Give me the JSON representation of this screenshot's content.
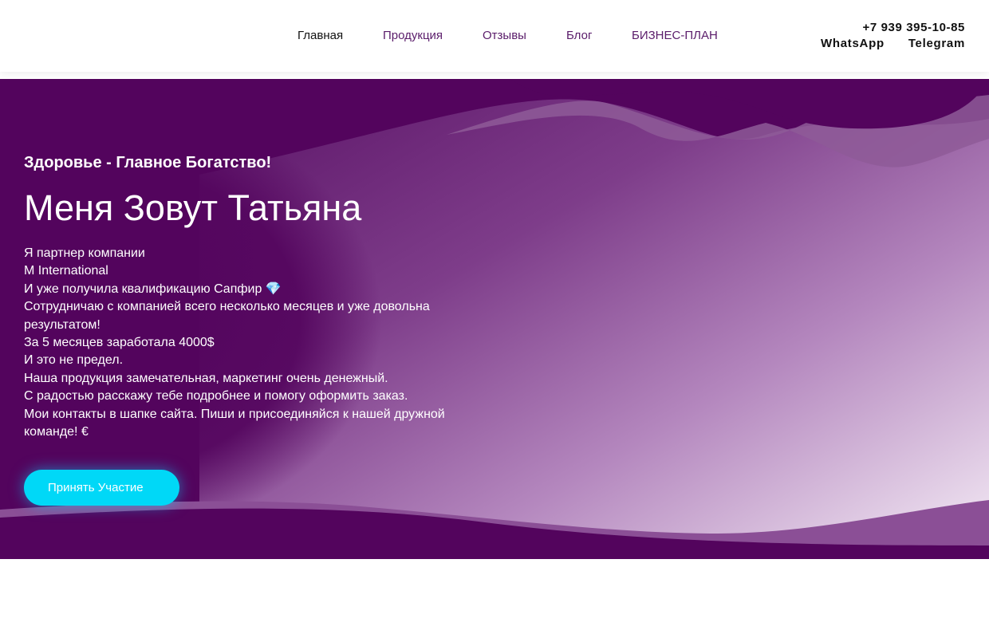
{
  "header": {
    "nav": [
      {
        "label": "Главная",
        "active": true
      },
      {
        "label": "Продукция",
        "active": false
      },
      {
        "label": "Отзывы",
        "active": false
      },
      {
        "label": "Блог",
        "active": false
      },
      {
        "label": "БИЗНЕС-ПЛАН",
        "active": false
      }
    ],
    "phone": "+7 939 395-10-85",
    "whatsapp": "WhatsApp",
    "telegram": "Telegram"
  },
  "hero": {
    "subtitle": "Здоровье - Главное Богатство!",
    "title": "Меня Зовут Татьяна",
    "lines": [
      "Я партнер компании",
      "M International",
      "И уже получила квалификацию Сапфир 💎",
      "Сотрудничаю с компанией всего несколько месяцев и уже довольна результатом!",
      "За 5 месяцев заработала 4000$",
      "И это не предел.",
      "Наша продукция замечательная, маркетинг очень денежный.",
      "С радостью расскажу тебе подробнее и помогу оформить заказ.",
      "Мои контакты в шапке сайта. Пиши и присоединяйся к нашей дружной команде! €"
    ],
    "cta_label": "Принять Участие"
  },
  "colors": {
    "hero_bg": "#53045d",
    "accent": "#00d8f7",
    "nav_link": "#5a1c6a"
  }
}
